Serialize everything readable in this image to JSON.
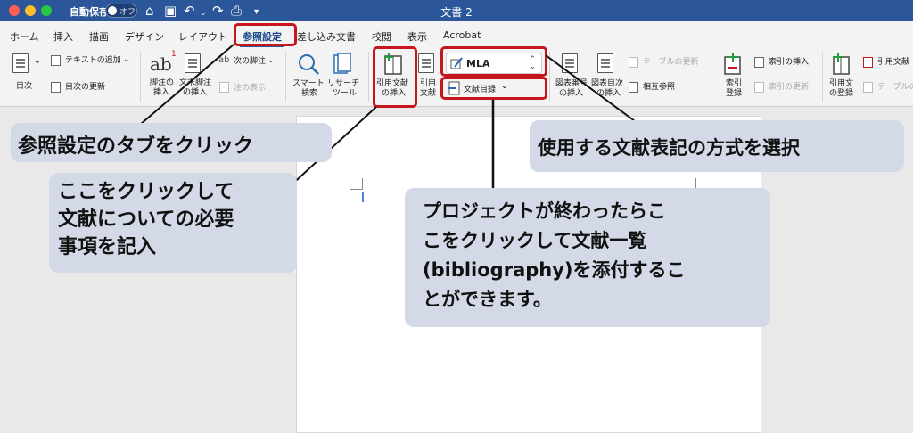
{
  "titlebar": {
    "autosave_label": "自動保存",
    "autosave_state": "オフ",
    "document_title": "文書 2",
    "icons": [
      "home-icon",
      "save-icon",
      "undo-icon",
      "redo-icon",
      "print-icon",
      "customize-icon"
    ]
  },
  "tabs": [
    {
      "label": "ホーム"
    },
    {
      "label": "挿入"
    },
    {
      "label": "描画"
    },
    {
      "label": "デザイン"
    },
    {
      "label": "レイアウト"
    },
    {
      "label": "参照設定",
      "active": true
    },
    {
      "label": "差し込み文書"
    },
    {
      "label": "校閲"
    },
    {
      "label": "表示"
    },
    {
      "label": "Acrobat"
    }
  ],
  "ribbon": {
    "toc": "目次",
    "add_text": "テキストの追加",
    "update_toc": "目次の更新",
    "insert_footnote_1": "脚注の",
    "insert_footnote_2": "挿入",
    "insert_endnote_1": "文末脚注",
    "insert_endnote_2": "の挿入",
    "next_footnote": "次の脚注",
    "show_notes": "注の表示",
    "smart_lookup_1": "スマート",
    "smart_lookup_2": "検索",
    "researcher_1": "リサーチ",
    "researcher_2": "ツール",
    "insert_citation_1": "引用文献",
    "insert_citation_2": "の挿入",
    "citations_1": "引用",
    "citations_2": "文献",
    "citation_style": "MLA",
    "bibliography": "文献目録",
    "insert_caption_1": "図表番号",
    "insert_caption_2": "の挿入",
    "insert_table_of_figures_1": "図表目次",
    "insert_table_of_figures_2": "の挿入",
    "update_table": "テーブルの更新",
    "cross_reference": "相互参照",
    "mark_entry_1": "索引",
    "mark_entry_2": "登録",
    "insert_index": "索引の挿入",
    "update_index": "索引の更新",
    "mark_citation_1": "引用文",
    "mark_citation_2": "の登録",
    "insert_table_of_authorities": "引用文献一",
    "update_table_2": "テーブルの"
  },
  "callouts": {
    "references_tab": "参照設定のタブをクリック",
    "insert_citation": [
      "ここをクリックして",
      "文献についての必要",
      "事項を記入"
    ],
    "style_select": "使用する文献表記の方式を選択",
    "bibliography": [
      "プロジェクトが終わったらこ",
      "こをクリックして文献一覧",
      "(bibliography)を添付するこ",
      "とができます。"
    ]
  },
  "colors": {
    "titlebar": "#2b579a",
    "highlight": "#c4161c",
    "callout_bg": "#d3d9e6"
  }
}
